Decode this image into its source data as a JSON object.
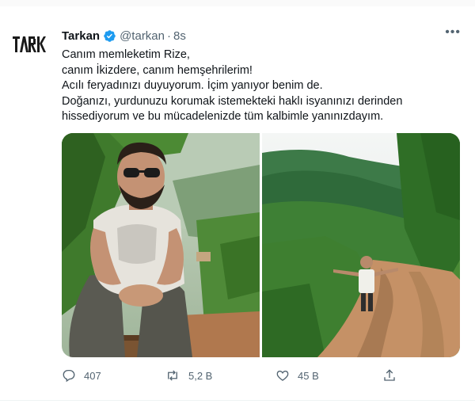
{
  "top_strip_text": "",
  "tweet": {
    "author_name": "Tarkan",
    "handle": "@tarkan",
    "separator": "·",
    "time": "8s",
    "verified": true,
    "more_label": "•••",
    "avatar_text": "TARKAN",
    "lines": [
      "Canım memleketim Rize,",
      "canım İkizdere, canım hemşehrilerim!",
      "Acılı feryadınızı duyuyorum. İçim yanıyor benim de.",
      "Doğanızı, yurdunuzu korumak istemekteki haklı isyanınızı derinden",
      "hissediyorum ve bu mücadelenizde tüm kalbimle yanınızdayım."
    ]
  },
  "media": [
    {
      "name": "photo-man-sitting",
      "icon": "photo"
    },
    {
      "name": "photo-man-on-road",
      "icon": "photo"
    }
  ],
  "actions": {
    "reply_count": "407",
    "retweet_count": "5,2 B",
    "like_count": "45 B",
    "reply_icon": "reply-icon",
    "retweet_icon": "retweet-icon",
    "like_icon": "heart-icon",
    "share_icon": "share-icon"
  },
  "colors": {
    "accent": "#1d9bf0",
    "muted": "#536471",
    "text": "#0f1419"
  }
}
